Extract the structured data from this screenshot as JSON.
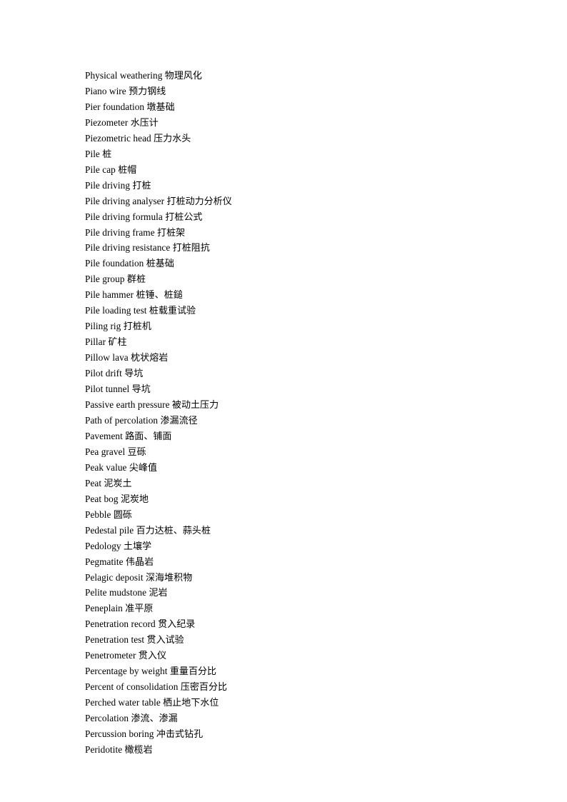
{
  "document": {
    "type": "glossary-page",
    "background_color": "#ffffff",
    "text_color": "#000000",
    "entries": [
      {
        "english": "Physical weathering",
        "chinese": "物理风化"
      },
      {
        "english": "Piano wire",
        "chinese": "预力钢线"
      },
      {
        "english": "Pier foundation",
        "chinese": "墩基础"
      },
      {
        "english": "Piezometer",
        "chinese": "水压计"
      },
      {
        "english": "Piezometric head",
        "chinese": "压力水头"
      },
      {
        "english": "Pile",
        "chinese": "桩"
      },
      {
        "english": "Pile cap",
        "chinese": "桩帽"
      },
      {
        "english": "Pile driving",
        "chinese": "打桩"
      },
      {
        "english": "Pile driving analyser",
        "chinese": "打桩动力分析仪"
      },
      {
        "english": "Pile driving formula",
        "chinese": "打桩公式"
      },
      {
        "english": "Pile driving frame",
        "chinese": "打桩架"
      },
      {
        "english": "Pile driving resistance",
        "chinese": "打桩阻抗"
      },
      {
        "english": "Pile foundation",
        "chinese": "桩基础"
      },
      {
        "english": "Pile group",
        "chinese": "群桩"
      },
      {
        "english": "Pile hammer",
        "chinese": "桩锤、桩鎚"
      },
      {
        "english": "Pile loading test",
        "chinese": "桩载重试验"
      },
      {
        "english": "Piling rig",
        "chinese": "打桩机"
      },
      {
        "english": "Pillar",
        "chinese": "矿柱"
      },
      {
        "english": "Pillow lava",
        "chinese": "枕状熔岩"
      },
      {
        "english": "Pilot drift",
        "chinese": "导坑"
      },
      {
        "english": "Pilot tunnel",
        "chinese": "导坑"
      },
      {
        "english": "Passive earth pressure",
        "chinese": "被动土压力"
      },
      {
        "english": "Path of percolation",
        "chinese": "渗漏流径"
      },
      {
        "english": "Pavement",
        "chinese": "路面、铺面"
      },
      {
        "english": "Pea gravel",
        "chinese": "豆砾"
      },
      {
        "english": "Peak value",
        "chinese": "尖峰值"
      },
      {
        "english": "Peat",
        "chinese": "泥炭土"
      },
      {
        "english": "Peat bog",
        "chinese": "泥炭地"
      },
      {
        "english": "Pebble",
        "chinese": "圆砾"
      },
      {
        "english": "Pedestal pile",
        "chinese": "百力达桩、蒜头桩"
      },
      {
        "english": "Pedology",
        "chinese": "土壤学"
      },
      {
        "english": "Pegmatite",
        "chinese": "伟晶岩"
      },
      {
        "english": "Pelagic deposit",
        "chinese": "深海堆积物"
      },
      {
        "english": "Pelite mudstone",
        "chinese": "泥岩"
      },
      {
        "english": "Peneplain",
        "chinese": "准平原"
      },
      {
        "english": "Penetration record",
        "chinese": "贯入纪录"
      },
      {
        "english": "Penetration test",
        "chinese": "贯入试验"
      },
      {
        "english": "Penetrometer",
        "chinese": "贯入仪"
      },
      {
        "english": "Percentage by weight",
        "chinese": "重量百分比"
      },
      {
        "english": "Percent of consolidation",
        "chinese": "压密百分比"
      },
      {
        "english": "Perched water table",
        "chinese": "栖止地下水位"
      },
      {
        "english": "Percolation",
        "chinese": "渗流、渗漏"
      },
      {
        "english": "Percussion boring",
        "chinese": "冲击式钻孔"
      },
      {
        "english": "Peridotite",
        "chinese": "橄榄岩"
      }
    ]
  }
}
